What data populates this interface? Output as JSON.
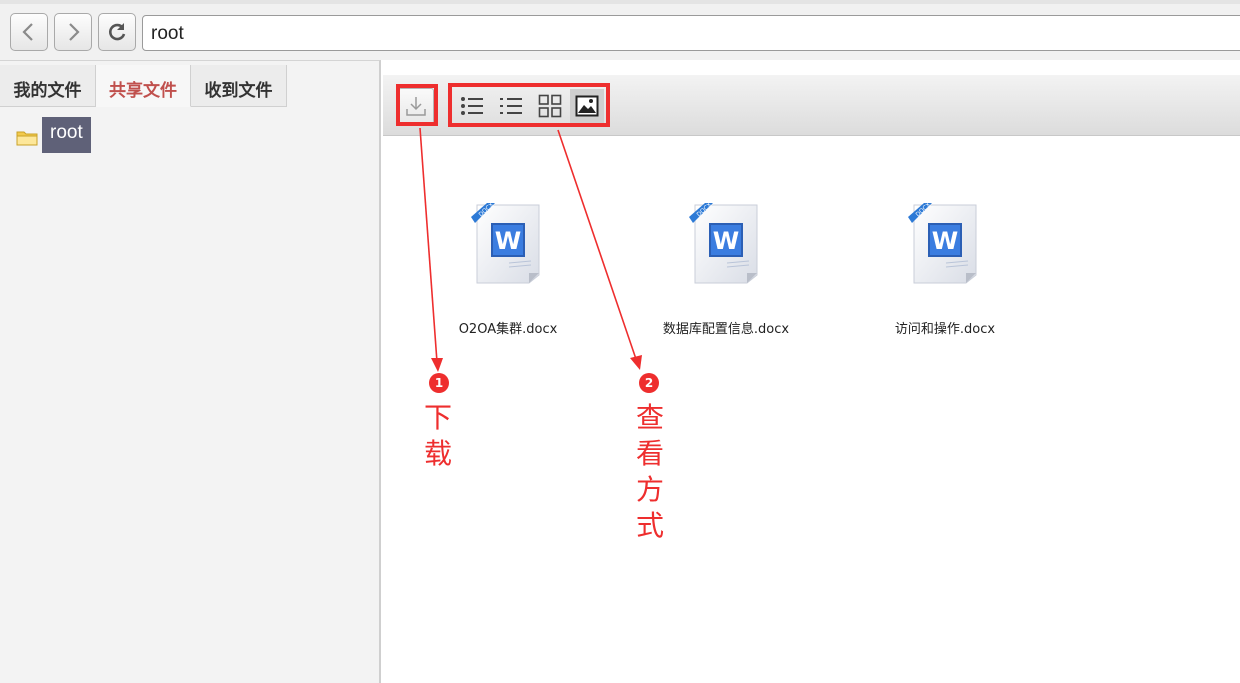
{
  "nav": {
    "back_icon": "chevron-left-icon",
    "forward_icon": "chevron-right-icon",
    "refresh_icon": "refresh-icon",
    "address": "root"
  },
  "sidebar": {
    "tabs": [
      {
        "label": "我的文件"
      },
      {
        "label": "共享文件",
        "active": true
      },
      {
        "label": "收到文件"
      }
    ],
    "tree": {
      "folder_icon": "folder-icon",
      "label": "root"
    }
  },
  "toolbar": {
    "download_icon": "download-icon",
    "view_modes": [
      {
        "icon": "list-detail-icon"
      },
      {
        "icon": "list-icon"
      },
      {
        "icon": "grid-icon"
      },
      {
        "icon": "thumbnail-icon",
        "selected": true
      }
    ]
  },
  "files": [
    {
      "name": "O2OA集群.docx",
      "icon": "word-docx-icon",
      "badge": "DOCX"
    },
    {
      "name": "数据库配置信息.docx",
      "icon": "word-docx-icon",
      "badge": "DOCX"
    },
    {
      "name": "访问和操作.docx",
      "icon": "word-docx-icon",
      "badge": "DOCX"
    }
  ],
  "annotations": [
    {
      "number": "1",
      "text": "下载"
    },
    {
      "number": "2",
      "text": "查看方式"
    }
  ],
  "colors": {
    "annotation": "#ee2e2e",
    "active_tab": "#c0504d",
    "tree_selected": "#5f6178"
  }
}
